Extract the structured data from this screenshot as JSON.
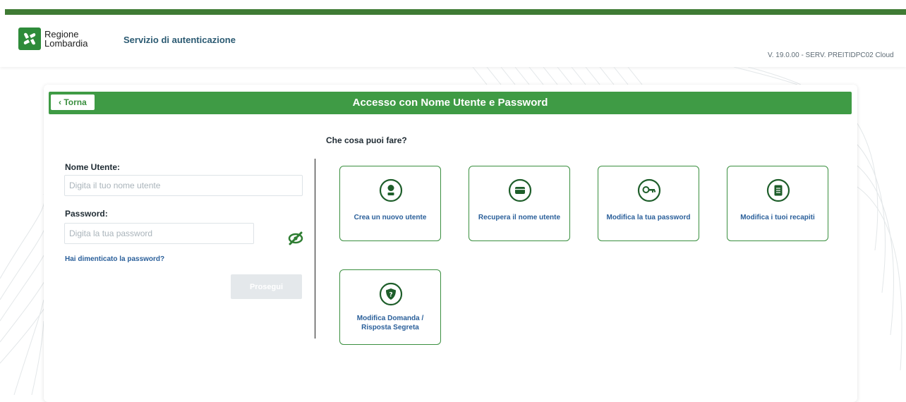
{
  "header": {
    "logo_line1": "Regione",
    "logo_line2": "Lombardia",
    "service": "Servizio di autenticazione",
    "version": "V. 19.0.00 - SERV. PREITIDPC02 Cloud"
  },
  "card": {
    "back_label": "‹ Torna",
    "title": "Accesso con Nome Utente e Password"
  },
  "login": {
    "username_label": "Nome Utente:",
    "username_placeholder": "Digita il tuo nome utente",
    "username_value": "",
    "password_label": "Password:",
    "password_placeholder": "Digita la tua password",
    "password_value": "",
    "forgot_link": "Hai dimenticato la password?",
    "submit_label": "Prosegui",
    "toggle_icon": "eye-slash-icon"
  },
  "actions": {
    "heading": "Che cosa puoi fare?",
    "items": [
      {
        "label": "Crea un nuovo utente",
        "icon": "user-icon"
      },
      {
        "label": "Recupera il nome utente",
        "icon": "id-card-icon"
      },
      {
        "label": "Modifica la tua password",
        "icon": "key-icon"
      },
      {
        "label": "Modifica i tuoi recapiti",
        "icon": "document-icon"
      },
      {
        "label_line1": "Modifica Domanda /",
        "label_line2": "Risposta Segreta",
        "icon": "shield-question-icon"
      }
    ]
  },
  "colors": {
    "brand_green": "#3f9b45",
    "dark_green": "#3f7b34",
    "link_blue": "#2a5f9a"
  }
}
